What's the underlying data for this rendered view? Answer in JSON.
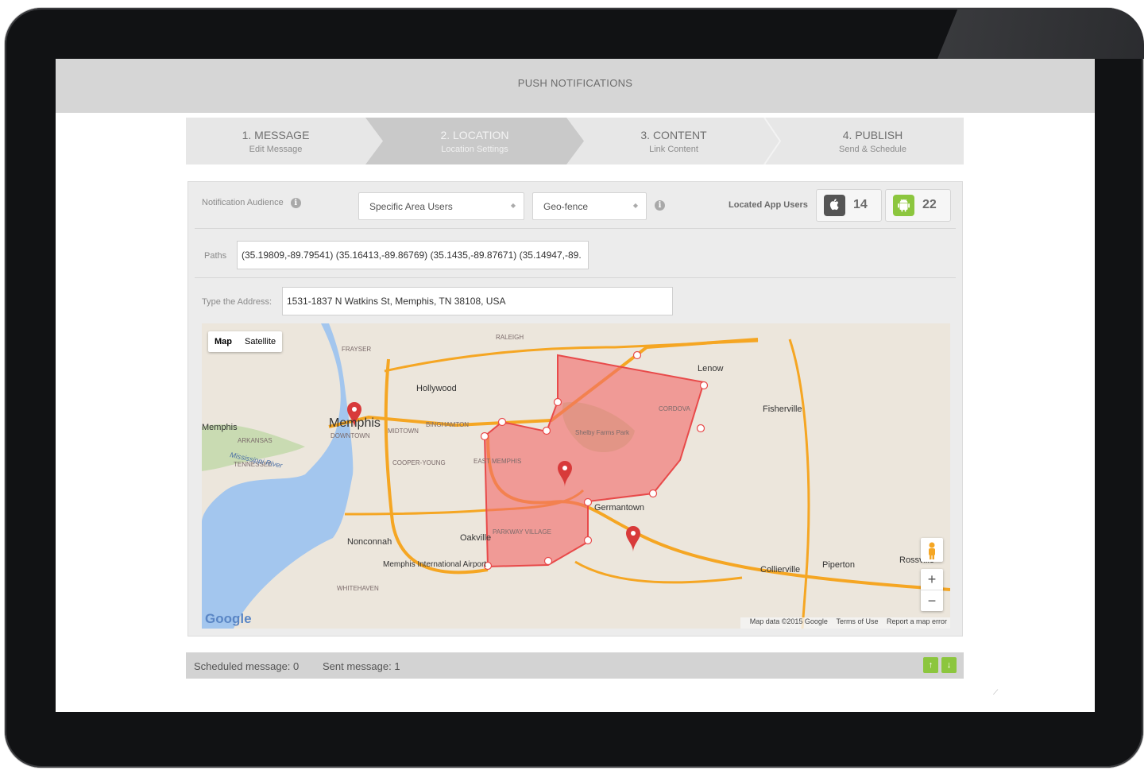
{
  "header": {
    "title": "PUSH NOTIFICATIONS"
  },
  "steps": [
    {
      "number": "1. MESSAGE",
      "subtitle": "Edit Message",
      "active": false
    },
    {
      "number": "2. LOCATION",
      "subtitle": "Location Settings",
      "active": true
    },
    {
      "number": "3. CONTENT",
      "subtitle": "Link Content",
      "active": false
    },
    {
      "number": "4. PUBLISH",
      "subtitle": "Send & Schedule",
      "active": false
    }
  ],
  "audience": {
    "label": "Notification Audience",
    "target_select": "Specific Area Users",
    "method_select": "Geo-fence",
    "located_label": "Located App Users",
    "ios_count": "14",
    "android_count": "22"
  },
  "paths": {
    "label": "Paths",
    "value": "(35.19809,-89.79541) (35.16413,-89.86769) (35.1435,-89.87671) (35.14947,-89."
  },
  "address": {
    "label": "Type the Address:",
    "value": "1531-1837 N Watkins St, Memphis, TN 38108, USA"
  },
  "map": {
    "type_buttons": [
      "Map",
      "Satellite"
    ],
    "selected_type": "Map",
    "place_labels": {
      "memphis": "Memphis",
      "hollywood": "Hollywood",
      "lenow": "Lenow",
      "fisherville": "Fisherville",
      "cordova": "CORDOVA",
      "shelby": "Shelby Farms Park",
      "germantown": "Germantown",
      "nonconnah": "Nonconnah",
      "oakville": "Oakville",
      "airport": "Memphis International Airport",
      "collierville": "Collierville",
      "piperton": "Piperton",
      "rossville": "Rossville",
      "arkansas": "ARKANSAS",
      "tennessee": "TENNESSEE",
      "mississippi_river": "Mississippi River",
      "midtown": "MIDTOWN",
      "downtown": "DOWNTOWN",
      "binghampton": "BINGHAMTON",
      "east_memphis": "EAST MEMPHIS",
      "cooper_young": "COOPER-YOUNG",
      "parkway_village": "PARKWAY VILLAGE",
      "whitehaven": "WHITEHAVEN",
      "raleigh": "RALEIGH",
      "frayser": "FRAYSER",
      "memphis_left": "Memphis"
    },
    "attribution": {
      "data": "Map data ©2015 Google",
      "terms": "Terms of Use",
      "report": "Report a map error"
    },
    "logo": "Google",
    "zoom_in": "+",
    "zoom_out": "−",
    "fence_color": "#f26b6b"
  },
  "footer": {
    "scheduled": "Scheduled message: 0",
    "sent": "Sent message: 1",
    "up": "↑",
    "down": "↓"
  },
  "colors": {
    "android_green": "#8cc63e",
    "apple_dark": "#555555",
    "accent_green": "#8cc63e"
  }
}
